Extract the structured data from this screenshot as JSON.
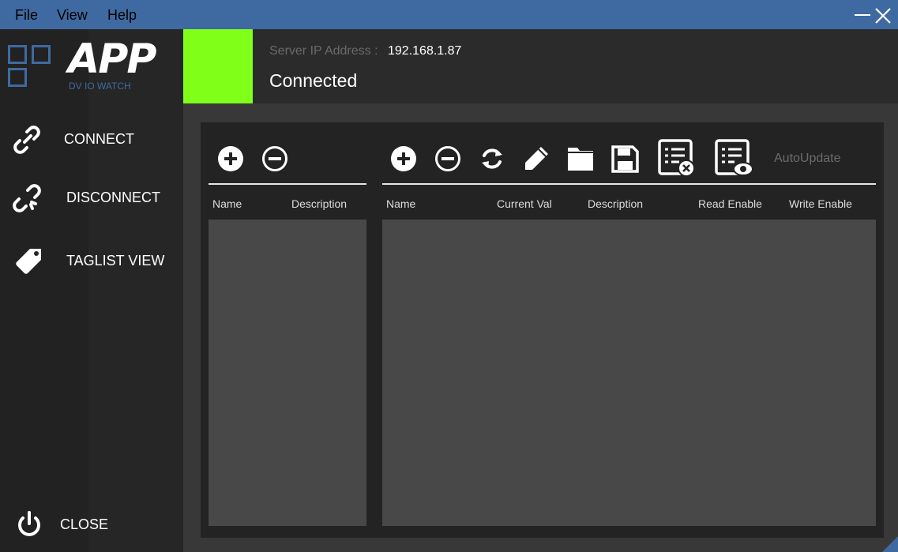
{
  "menu": {
    "file": "File",
    "view": "View",
    "help": "Help"
  },
  "window_controls": {
    "minimize_icon": "minimize-icon",
    "close_icon": "close-icon"
  },
  "logo": {
    "app": "APP",
    "subtitle": "DV IO WATCH"
  },
  "sidebar": {
    "items": [
      {
        "label": "CONNECT",
        "icon": "link-icon"
      },
      {
        "label": "DISCONNECT",
        "icon": "unlink-icon"
      },
      {
        "label": "TAGLIST VIEW",
        "icon": "tag-icon"
      }
    ],
    "close": {
      "label": "CLOSE",
      "icon": "power-icon"
    }
  },
  "status": {
    "ip_label": "Server IP Address :",
    "ip_value": "192.168.1.87",
    "connection": "Connected",
    "led_color": "#80ff19"
  },
  "left_grid": {
    "toolbar": [
      "add-icon",
      "remove-icon"
    ],
    "columns": [
      "Name",
      "Description"
    ],
    "rows": []
  },
  "right_grid": {
    "toolbar": [
      "add-icon",
      "remove-icon",
      "refresh-icon",
      "edit-icon",
      "folder-icon",
      "save-icon",
      "list-delete-icon",
      "list-view-icon"
    ],
    "autoupdate_label": "AutoUpdate",
    "columns": [
      "Name",
      "Current Val",
      "Description",
      "Read Enable",
      "Write Enable"
    ],
    "rows": []
  },
  "colors": {
    "accent": "#3f6aa1",
    "background": "#2b2b2b",
    "grid_body": "#484848"
  }
}
